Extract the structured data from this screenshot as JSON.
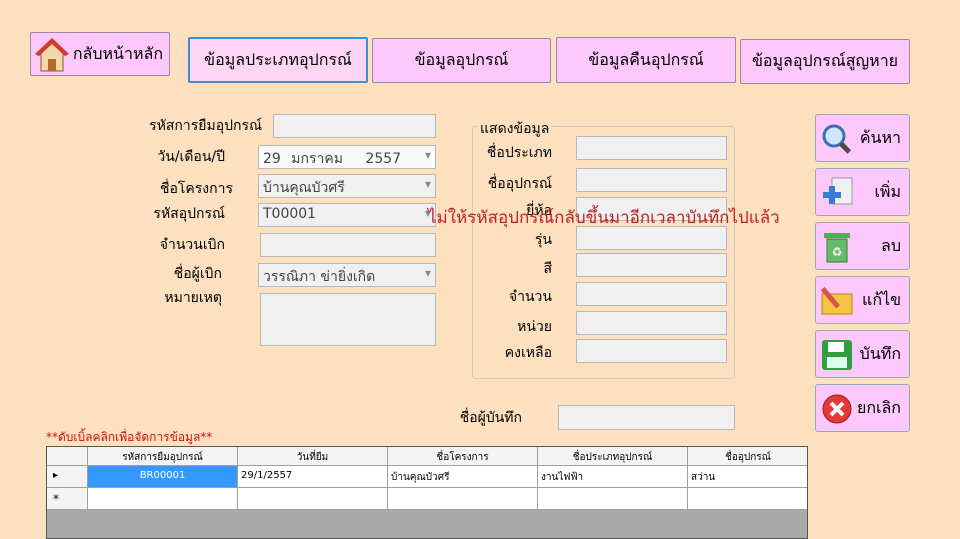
{
  "nav": {
    "home_label": "กลับหน้าหลัก",
    "tabs": [
      {
        "label": "ข้อมูลประเภทอุปกรณ์"
      },
      {
        "label": "ข้อมูลอุปกรณ์"
      },
      {
        "label": "ข้อมูลคืนอุปกรณ์"
      },
      {
        "label": "ข้อมูลอุปกรณ์สูญหาย"
      }
    ]
  },
  "form": {
    "borrow_code_label": "รหัสการยืมอุปกรณ์",
    "borrow_code_value": "",
    "date_label": "วัน/เดือน/ปี",
    "date_day": "29",
    "date_month": "มกราคม",
    "date_year": "2557",
    "project_label": "ชื่อโครงการ",
    "project_value": "บ้านคุณบัวศรี",
    "device_code_label": "รหัสอุปกรณ์",
    "device_code_value": "T00001",
    "quantity_label": "จำนวนเบิก",
    "quantity_value": "",
    "requester_label": "ชื่อผู้เบิก",
    "requester_value": "วรรณิภา ข่ายิ่งเกิด",
    "note_label": "หมายเหตุ",
    "note_value": ""
  },
  "display": {
    "group_title": "แสดงข้อมูล",
    "fields": [
      {
        "label": "ชื่อประเภท",
        "value": ""
      },
      {
        "label": "ชื่ออุปกรณ์",
        "value": ""
      },
      {
        "label": "ยี่ห้อ",
        "value": ""
      },
      {
        "label": "รุ่น",
        "value": ""
      },
      {
        "label": "สี",
        "value": ""
      },
      {
        "label": "จำนวน",
        "value": ""
      },
      {
        "label": "หน่วย",
        "value": ""
      },
      {
        "label": "คงเหลือ",
        "value": ""
      }
    ]
  },
  "annotation": "ไม่ให้รหัสอุปกรณ์กลับขึ้นมาอีกเวลาบันทึกไปแล้ว",
  "recorder": {
    "label": "ชื่อผู้บันทึก",
    "value": ""
  },
  "actions": {
    "search": "ค้นหา",
    "add": "เพิ่ม",
    "delete": "ลบ",
    "edit": "แก้ไข",
    "save": "บันทึก",
    "cancel": "ยกเลิก"
  },
  "hint": "**ดับเบิ้ลคลิกเพื่อจัดการข้อมูล**",
  "table": {
    "columns": [
      "รหัสการยืมอุปกรณ์",
      "วันที่ยืม",
      "ชื่อโครงการ",
      "ชื่อประเภทอุปกรณ์",
      "ชื่ออุปกรณ์"
    ],
    "rows": [
      [
        "BR00001",
        "29/1/2557",
        "บ้านคุณบัวศรี",
        "งานไฟฟ้า",
        "สว่าน"
      ]
    ],
    "current_row_marker": "▸",
    "new_row_marker": "*"
  },
  "colors": {
    "background": "#fde0c0",
    "button": "#fdc8fb",
    "annotation": "#c02020",
    "selected_cell": "#3399ff"
  }
}
